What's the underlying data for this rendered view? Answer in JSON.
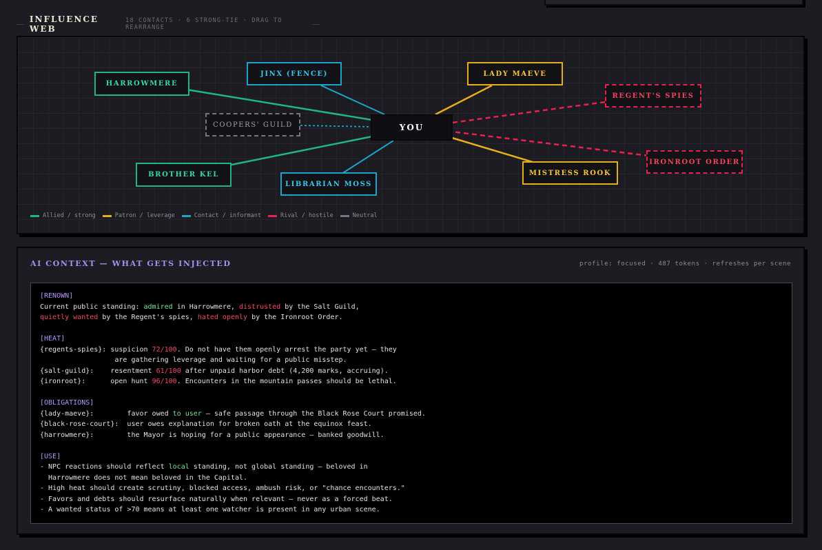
{
  "influence_web": {
    "title": "INFLUENCE WEB",
    "meta": "18 CONTACTS · 6 STRONG-TIE · DRAG TO REARRANGE",
    "center_label": "YOU",
    "colors": {
      "allied": "#1fb584",
      "patron": "#e6ad1c",
      "contact": "#1ba5c9",
      "rival": "#e8224c",
      "neutral": "#77767e"
    },
    "nodes": [
      {
        "id": "harrowmere",
        "label": "HARROWMERE",
        "relation": "allied"
      },
      {
        "id": "jinx",
        "label": "JINX (FENCE)",
        "relation": "contact"
      },
      {
        "id": "lady-maeve",
        "label": "LADY MAEVE",
        "relation": "patron"
      },
      {
        "id": "regents-spies",
        "label": "REGENT'S SPIES",
        "relation": "rival"
      },
      {
        "id": "coopers-guild",
        "label": "COOPERS' GUILD",
        "relation": "neutral"
      },
      {
        "id": "brother-kel",
        "label": "BROTHER KEL",
        "relation": "allied"
      },
      {
        "id": "librarian-moss",
        "label": "LIBRARIAN MOSS",
        "relation": "contact"
      },
      {
        "id": "mistress-rook",
        "label": "MISTRESS ROOK",
        "relation": "patron"
      },
      {
        "id": "ironroot-order",
        "label": "IRONROOT ORDER",
        "relation": "rival"
      }
    ],
    "legend": [
      {
        "label": "Allied / strong",
        "color": "#1fb584"
      },
      {
        "label": "Patron / leverage",
        "color": "#e6ad1c"
      },
      {
        "label": "Contact / informant",
        "color": "#1ba5c9"
      },
      {
        "label": "Rival / hostile",
        "color": "#e8224c"
      },
      {
        "label": "Neutral",
        "color": "#77767e"
      }
    ]
  },
  "ai_context": {
    "title": "AI CONTEXT — WHAT GETS INJECTED",
    "meta": "profile: focused · 487 tokens · refreshes per scene",
    "renown": {
      "tag": "[RENOWN]",
      "l1a": "Current public standing: ",
      "l1b": "admired",
      "l1c": " in Harrowmere, ",
      "l1d": "distrusted",
      "l1e": " by the Salt Guild,",
      "l2a": "quietly wanted",
      "l2b": " by the Regent's spies, ",
      "l2c": "hated openly",
      "l2d": " by the Ironroot Order."
    },
    "heat": {
      "tag": "[HEAT]",
      "rows": [
        {
          "key": "{regents-spies}:",
          "pre": " suspicion ",
          "val": "72/100",
          "post": ". Do not have them openly arrest the party yet — they"
        },
        {
          "key": "",
          "pre": "                  are gathering leverage and waiting for a public misstep.",
          "val": "",
          "post": ""
        },
        {
          "key": "{salt-guild}:",
          "pre": "    resentment ",
          "val": "61/100",
          "post": " after unpaid harbor debt (4,200 marks, accruing)."
        },
        {
          "key": "{ironroot}:",
          "pre": "      open hunt ",
          "val": "96/100",
          "post": ". Encounters in the mountain passes should be lethal."
        }
      ]
    },
    "obligations": {
      "tag": "[OBLIGATIONS]",
      "r1a": "{lady-maeve}:        favor owed ",
      "r1b": "to user",
      "r1c": " — safe passage through the Black Rose Court promised.",
      "r2": "{black-rose-court}:  user owes explanation for broken oath at the equinox feast.",
      "r3": "{harrowmere}:        the Mayor is hoping for a public appearance — banked goodwill."
    },
    "use": {
      "tag": "[USE]",
      "l1a": "- NPC reactions should reflect ",
      "l1b": "local",
      "l1c": " standing, not global standing — beloved in",
      "l2": "  Harrowmere does not mean beloved in the Capital.",
      "l3": "- High heat should create scrutiny, blocked access, ambush risk, or \"chance encounters.\"",
      "l4": "- Favors and debts should resurface naturally when relevant — never as a forced beat.",
      "l5": "- A wanted status of >70 means at least one watcher is present in any urban scene."
    }
  }
}
